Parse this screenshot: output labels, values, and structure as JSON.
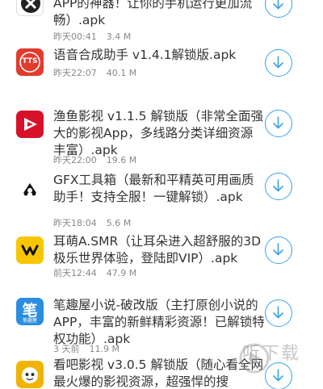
{
  "items": [
    {
      "title": "APP的神器！让你的手机运行更加流畅）.apk",
      "time": "昨天00:41",
      "size": "3.4 M"
    },
    {
      "title": "语音合成助手 v1.4.1解锁版.apk",
      "time": "昨天22:07",
      "size": "40.1 M",
      "icon_text": "TTS"
    },
    {
      "title": "渔鱼影视 v1.1.5 解锁版（非常全面强大的影视App，多线路分类详细资源丰富）.apk",
      "time": "昨天22:00",
      "size": "19.6 M"
    },
    {
      "title": "GFX工具箱（最新和平精英可用画质助手！支持全服！一键解锁）.apk",
      "time": "昨天18:04",
      "size": "5.6 M"
    },
    {
      "title": "耳萌A.SMR（让耳朵进入超舒服的3D极乐世界体验，登陆即VIP）.apk",
      "time": "前天12:44",
      "size": "47.9 M"
    },
    {
      "title": "笔趣屋小说-破改版（主打原创小说的APP，丰富的新鲜精彩资源！已解锁特权功能）.apk",
      "time": "3 天前",
      "size": "11.9 M",
      "icon_text": "笔",
      "icon_subtext": "笔趣屋"
    },
    {
      "title": "看吧影视 v3.0.5 解锁版（随心看全网最火爆的影视资源，超强悍的搜",
      "time": "",
      "size": ""
    }
  ],
  "watermark": {
    "text": "听下载"
  },
  "colors": {
    "accent": "#3ba2e6",
    "meta": "#888888",
    "title": "#333333"
  }
}
